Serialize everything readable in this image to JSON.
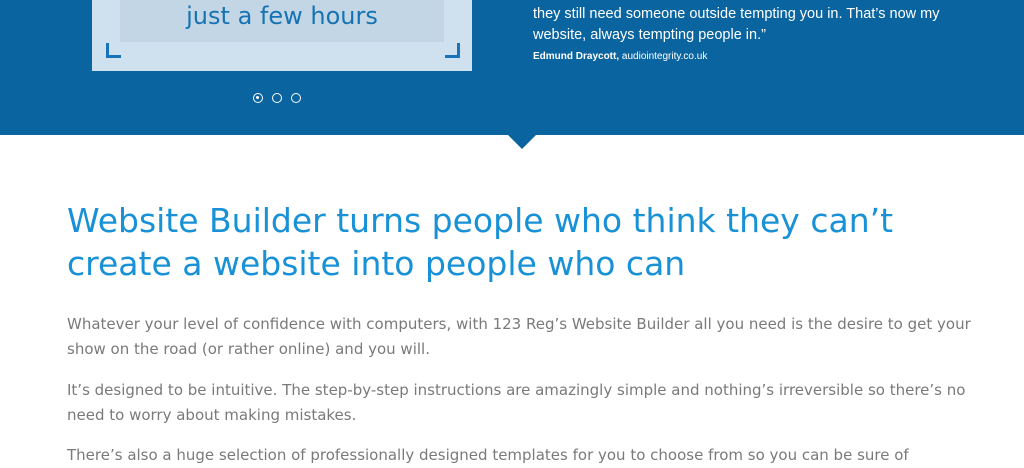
{
  "hero": {
    "slide_text": "just a few hours",
    "dots": [
      {
        "active": true
      },
      {
        "active": false
      },
      {
        "active": false
      }
    ],
    "testimonial": {
      "line1": "they still need someone outside tempting you in. That’s now my",
      "line2": "website, always tempting people in.”",
      "author": "Edmund Draycott,",
      "site": "audiointegrity.co.uk"
    }
  },
  "main": {
    "heading": "Website Builder turns people who think they can’t create a website into people who can",
    "paragraphs": [
      "Whatever your level of confidence with computers, with 123 Reg’s Website Builder all you need is the desire to get your show on the road (or rather online) and you will.",
      "It’s designed to be intuitive. The step-by-step instructions are amazingly simple and nothing’s irreversible so there’s no need to worry about making mistakes.",
      "There’s also a huge selection of professionally designed templates for you to choose from so you can be sure of"
    ]
  },
  "colors": {
    "hero_bg": "#0a64a0",
    "heading": "#1991d6",
    "body_text": "#7a7a7a"
  }
}
